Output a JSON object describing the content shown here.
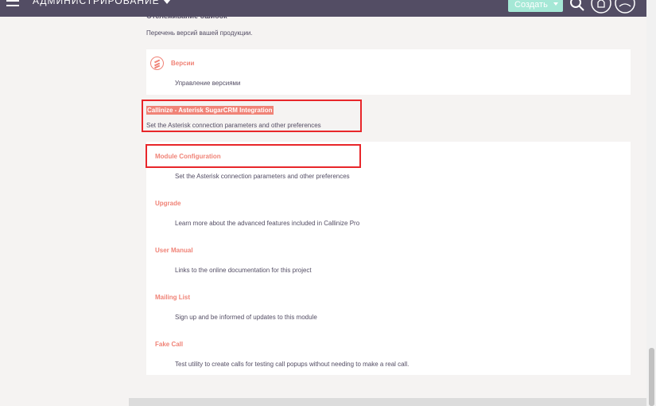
{
  "navbar": {
    "title": "АДМИНИСТРИРОВАНИЕ",
    "create_label": "Создать",
    "icons": [
      "menu-icon",
      "search-icon",
      "notification-icon",
      "user-icon"
    ]
  },
  "bug_tracking": {
    "title": "Отслеживание ошибок",
    "description": "Перечень версий вашей продукции.",
    "items": [
      {
        "label": "Версии",
        "description": "Управление версиями",
        "icon": "versions-icon"
      }
    ]
  },
  "callinize": {
    "title": "Callinize - Asterisk SugarCRM Integration",
    "description": "Set the Asterisk connection parameters and other preferences",
    "items": [
      {
        "label": "Module Configuration",
        "description": "Set the Asterisk connection parameters and other preferences"
      },
      {
        "label": "Upgrade",
        "description": "Learn more about the advanced features included in Callinize Pro"
      },
      {
        "label": "User Manual",
        "description": "Links to the online documentation for this project"
      },
      {
        "label": "Mailing List",
        "description": "Sign up and be informed of updates to this module"
      },
      {
        "label": "Fake Call",
        "description": "Test utility to create calls for testing call popups without needing to make a real call."
      }
    ]
  },
  "colors": {
    "navbar": "#534d64",
    "accent": "#f08377",
    "create_button": "#a5e8d6",
    "highlight_box": "#e8262a"
  }
}
